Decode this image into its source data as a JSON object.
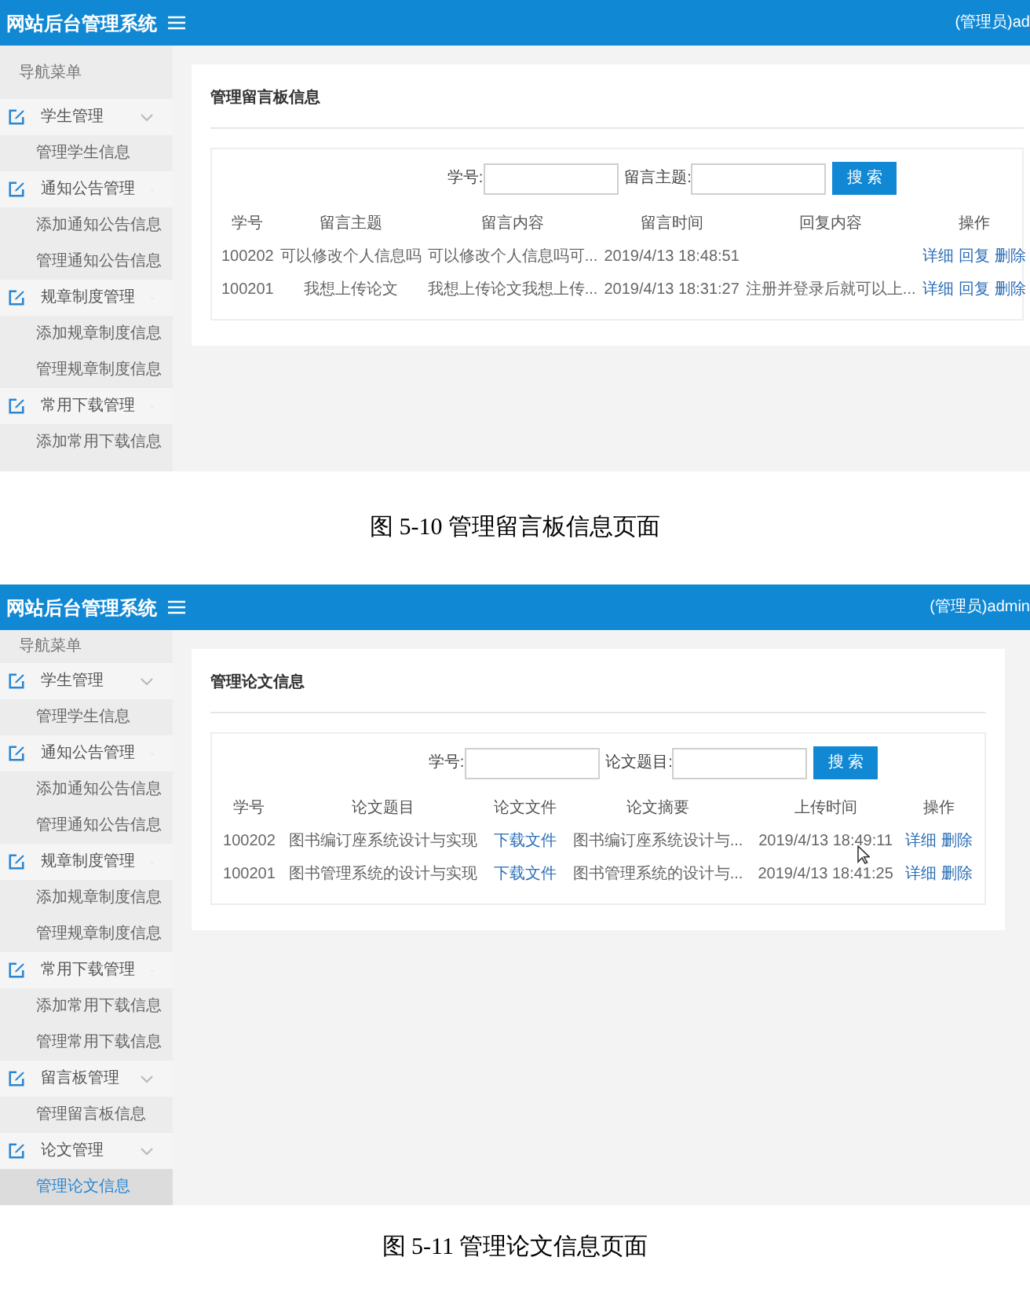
{
  "screenshots": [
    {
      "header": {
        "title": "网站后台管理系统",
        "user": "(管理员)ad"
      },
      "sidebar": {
        "heading": "导航菜单",
        "groups": [
          {
            "label": "学生管理",
            "children": [
              {
                "label": "管理学生信息",
                "selected": false
              }
            ]
          },
          {
            "label": "通知公告管理",
            "children": [
              {
                "label": "添加通知公告信息",
                "selected": false
              },
              {
                "label": "管理通知公告信息",
                "selected": false
              }
            ]
          },
          {
            "label": "规章制度管理",
            "children": [
              {
                "label": "添加规章制度信息",
                "selected": false
              },
              {
                "label": "管理规章制度信息",
                "selected": false
              }
            ]
          },
          {
            "label": "常用下载管理",
            "children": [
              {
                "label": "添加常用下载信息",
                "selected": false
              }
            ]
          }
        ]
      },
      "panel": {
        "title": "管理留言板信息",
        "search": {
          "fields": [
            {
              "label": "学号:"
            },
            {
              "label": "留言主题:"
            }
          ],
          "button": "搜 索"
        },
        "table": {
          "columns": [
            "学号",
            "留言主题",
            "留言内容",
            "留言时间",
            "回复内容",
            "操作"
          ],
          "rows": [
            {
              "cells": [
                {
                  "kind": "text",
                  "text": "100202"
                },
                {
                  "kind": "text",
                  "text": "可以修改个人信息吗"
                },
                {
                  "kind": "text",
                  "text": "可以修改个人信息吗可..."
                },
                {
                  "kind": "text",
                  "text": "2019/4/13 18:48:51"
                },
                {
                  "kind": "text",
                  "text": ""
                }
              ],
              "actions": [
                "详细",
                "回复",
                "删除"
              ]
            },
            {
              "cells": [
                {
                  "kind": "text",
                  "text": "100201"
                },
                {
                  "kind": "text",
                  "text": "我想上传论文"
                },
                {
                  "kind": "text",
                  "text": "我想上传论文我想上传..."
                },
                {
                  "kind": "text",
                  "text": "2019/4/13 18:31:27"
                },
                {
                  "kind": "text",
                  "text": "注册并登录后就可以上..."
                }
              ],
              "actions": [
                "详细",
                "回复",
                "删除"
              ]
            }
          ]
        }
      },
      "cursor": false,
      "caption": "图 5-10 管理留言板信息页面"
    },
    {
      "header": {
        "title": "网站后台管理系统",
        "user": "(管理员)admin"
      },
      "sidebar": {
        "heading": "导航菜单",
        "groups": [
          {
            "label": "学生管理",
            "children": [
              {
                "label": "管理学生信息",
                "selected": false
              }
            ]
          },
          {
            "label": "通知公告管理",
            "children": [
              {
                "label": "添加通知公告信息",
                "selected": false
              },
              {
                "label": "管理通知公告信息",
                "selected": false
              }
            ]
          },
          {
            "label": "规章制度管理",
            "children": [
              {
                "label": "添加规章制度信息",
                "selected": false
              },
              {
                "label": "管理规章制度信息",
                "selected": false
              }
            ]
          },
          {
            "label": "常用下载管理",
            "children": [
              {
                "label": "添加常用下载信息",
                "selected": false
              },
              {
                "label": "管理常用下载信息",
                "selected": false
              }
            ]
          },
          {
            "label": "留言板管理",
            "children": [
              {
                "label": "管理留言板信息",
                "selected": false
              }
            ]
          },
          {
            "label": "论文管理",
            "children": [
              {
                "label": "管理论文信息",
                "selected": true
              }
            ]
          }
        ]
      },
      "panel": {
        "title": "管理论文信息",
        "search": {
          "fields": [
            {
              "label": "学号:"
            },
            {
              "label": "论文题目:"
            }
          ],
          "button": "搜 索"
        },
        "table": {
          "columns": [
            "学号",
            "论文题目",
            "论文文件",
            "论文摘要",
            "上传时间",
            "操作"
          ],
          "rows": [
            {
              "cells": [
                {
                  "kind": "text",
                  "text": "100202"
                },
                {
                  "kind": "text",
                  "text": "图书编订座系统设计与实现"
                },
                {
                  "kind": "link",
                  "text": "下载文件"
                },
                {
                  "kind": "text",
                  "text": "图书编订座系统设计与..."
                },
                {
                  "kind": "text",
                  "text": "2019/4/13 18:49:11"
                }
              ],
              "actions": [
                "详细",
                "删除"
              ]
            },
            {
              "cells": [
                {
                  "kind": "text",
                  "text": "100201"
                },
                {
                  "kind": "text",
                  "text": "图书管理系统的设计与实现"
                },
                {
                  "kind": "link",
                  "text": "下载文件"
                },
                {
                  "kind": "text",
                  "text": "图书管理系统的设计与..."
                },
                {
                  "kind": "text",
                  "text": "2019/4/13 18:41:25"
                }
              ],
              "actions": [
                "详细",
                "删除"
              ]
            }
          ]
        }
      },
      "cursor": true,
      "caption": "图 5-11 管理论文信息页面"
    }
  ]
}
